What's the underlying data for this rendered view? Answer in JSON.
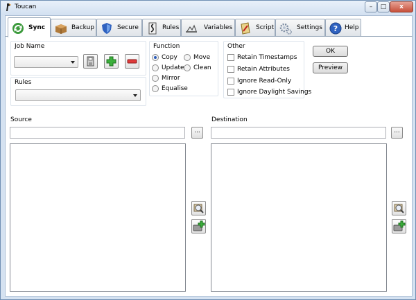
{
  "window": {
    "title": "Toucan",
    "close": "x",
    "maximize": "□",
    "minimize": "–"
  },
  "tabs": [
    {
      "label": "Sync",
      "icon": "sync-icon",
      "active": true
    },
    {
      "label": "Backup",
      "icon": "backup-box-icon"
    },
    {
      "label": "Secure",
      "icon": "shield-icon"
    },
    {
      "label": "Rules",
      "icon": "rules-icon"
    },
    {
      "label": "Variables",
      "icon": "variables-icon"
    },
    {
      "label": "Script",
      "icon": "script-icon"
    },
    {
      "label": "Settings",
      "icon": "settings-gear-icon"
    },
    {
      "label": "Help",
      "icon": "help-icon"
    }
  ],
  "sync": {
    "job_name_label": "Job Name",
    "job_name_value": "",
    "rules_label": "Rules",
    "rules_value": "",
    "function_label": "Function",
    "functions": [
      {
        "label": "Copy",
        "checked": true
      },
      {
        "label": "Move",
        "checked": false
      },
      {
        "label": "Update",
        "checked": false
      },
      {
        "label": "Clean",
        "checked": false
      },
      {
        "label": "Mirror",
        "checked": false
      },
      {
        "label": "Equalise",
        "checked": false
      }
    ],
    "other_label": "Other",
    "others": [
      {
        "label": "Retain Timestamps",
        "checked": false
      },
      {
        "label": "Retain Attributes",
        "checked": false
      },
      {
        "label": "Ignore Read-Only",
        "checked": false
      },
      {
        "label": "Ignore Daylight Savings",
        "checked": false
      }
    ],
    "ok_label": "OK",
    "preview_label": "Preview",
    "source_label": "Source",
    "source_value": "",
    "destination_label": "Destination",
    "destination_value": "",
    "browse_label": "..."
  },
  "colors": {
    "accent": "#2a5bb8",
    "window_bg": "#d5e2f1"
  }
}
